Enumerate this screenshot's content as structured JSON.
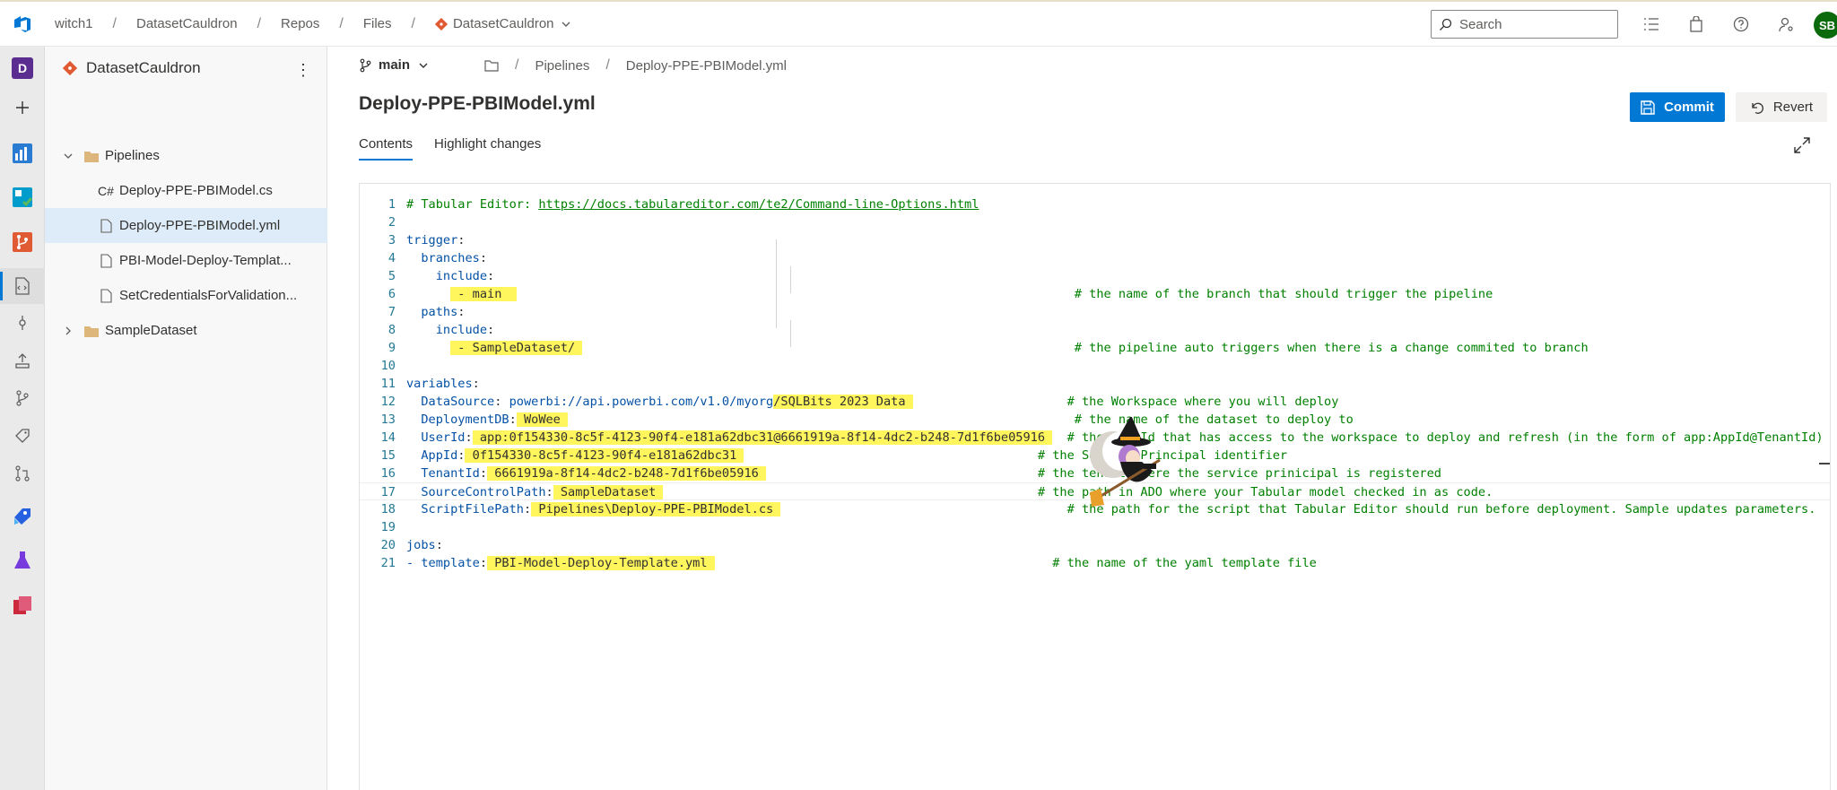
{
  "topbar": {
    "crumbs": [
      "witch1",
      "DatasetCauldron",
      "Repos",
      "Files"
    ],
    "repo_crumb": "DatasetCauldron",
    "search_placeholder": "Search",
    "avatar_initials": "SB"
  },
  "rail": {
    "project_badge": "D"
  },
  "tree": {
    "repo_name": "DatasetCauldron",
    "items": [
      {
        "label": "Pipelines",
        "type": "folder",
        "expanded": true
      },
      {
        "label": "Deploy-PPE-PBIModel.cs",
        "type": "cs-file",
        "prefix": "C#"
      },
      {
        "label": "Deploy-PPE-PBIModel.yml",
        "type": "file",
        "selected": true
      },
      {
        "label": "PBI-Model-Deploy-Templat...",
        "type": "file"
      },
      {
        "label": "SetCredentialsForValidation...",
        "type": "file"
      },
      {
        "label": "SampleDataset",
        "type": "folder",
        "expanded": false
      }
    ]
  },
  "main": {
    "branch": "main",
    "path": [
      "Pipelines",
      "Deploy-PPE-PBIModel.yml"
    ],
    "file_title": "Deploy-PPE-PBIModel.yml",
    "commit_label": "Commit",
    "revert_label": "Revert",
    "tabs": [
      "Contents",
      "Highlight changes"
    ],
    "active_tab": "Contents"
  },
  "code": {
    "lines": [
      [
        {
          "t": "# Tabular Editor: ",
          "c": "comment"
        },
        {
          "t": "https://docs.tabulareditor.com/te2/Command-line-Options.html",
          "c": "link"
        }
      ],
      [],
      [
        {
          "t": "trigger",
          "c": "key"
        },
        {
          "t": ":",
          "c": "plain"
        }
      ],
      [
        {
          "t": "  branches",
          "c": "key"
        },
        {
          "t": ":",
          "c": "plain"
        }
      ],
      [
        {
          "t": "    include",
          "c": "key"
        },
        {
          "t": ":",
          "c": "plain"
        }
      ],
      [
        {
          "t": "      ",
          "c": "plain"
        },
        {
          "t": " - main  ",
          "c": "plain",
          "hl": true
        },
        {
          "t": "                                                                            ",
          "c": "plain"
        },
        {
          "t": "# the name of the branch that should trigger the pipeline",
          "c": "comment"
        }
      ],
      [
        {
          "t": "  paths",
          "c": "key"
        },
        {
          "t": ":",
          "c": "plain"
        }
      ],
      [
        {
          "t": "    include",
          "c": "key"
        },
        {
          "t": ":",
          "c": "plain"
        }
      ],
      [
        {
          "t": "      ",
          "c": "plain"
        },
        {
          "t": " - SampleDataset/ ",
          "c": "plain",
          "hl": true
        },
        {
          "t": "                                                                   ",
          "c": "plain"
        },
        {
          "t": "# the pipeline auto triggers when there is a change commited to branch",
          "c": "comment"
        }
      ],
      [],
      [
        {
          "t": "variables",
          "c": "key"
        },
        {
          "t": ":",
          "c": "plain"
        }
      ],
      [
        {
          "t": "  DataSource",
          "c": "key"
        },
        {
          "t": ": ",
          "c": "plain"
        },
        {
          "t": "powerbi://api.powerbi.com/v1.0/myorg",
          "c": "key"
        },
        {
          "t": "/SQLBits 2023 Data ",
          "c": "plain",
          "hl": true
        },
        {
          "t": "                     ",
          "c": "plain"
        },
        {
          "t": "# the Workspace where you will deploy",
          "c": "comment"
        }
      ],
      [
        {
          "t": "  DeploymentDB",
          "c": "key"
        },
        {
          "t": ":",
          "c": "plain"
        },
        {
          "t": " WoWee ",
          "c": "plain",
          "hl": true
        },
        {
          "t": "                                                                     ",
          "c": "plain"
        },
        {
          "t": "# the name of the dataset to deploy to",
          "c": "comment"
        }
      ],
      [
        {
          "t": "  UserId",
          "c": "key"
        },
        {
          "t": ":",
          "c": "plain"
        },
        {
          "t": " app:0f154330-8c5f-4123-90f4-e181a62dbc31@6661919a-8f14-4dc2-b248-7d1f6be05916 ",
          "c": "plain",
          "hl": true
        },
        {
          "t": "  ",
          "c": "plain"
        },
        {
          "t": "# the UserId that has access to the workspace to deploy and refresh (in the form of app:AppId@TenantId)",
          "c": "comment"
        }
      ],
      [
        {
          "t": "  AppId",
          "c": "key"
        },
        {
          "t": ":",
          "c": "plain"
        },
        {
          "t": " 0f154330-8c5f-4123-90f4-e181a62dbc31 ",
          "c": "plain",
          "hl": true
        },
        {
          "t": "                                        ",
          "c": "plain"
        },
        {
          "t": "# the Service Principal identifier",
          "c": "comment"
        }
      ],
      [
        {
          "t": "  TenantId",
          "c": "key"
        },
        {
          "t": ":",
          "c": "plain"
        },
        {
          "t": " 6661919a-8f14-4dc2-b248-7d1f6be05916 ",
          "c": "plain",
          "hl": true
        },
        {
          "t": "                                     ",
          "c": "plain"
        },
        {
          "t": "# the tenant where the service prinicipal is registered",
          "c": "comment"
        }
      ],
      [
        {
          "t": "  SourceControlPath",
          "c": "key"
        },
        {
          "t": ":",
          "c": "plain"
        },
        {
          "t": " SampleDataset ",
          "c": "plain",
          "hl": true
        },
        {
          "t": "                                                   ",
          "c": "plain"
        },
        {
          "t": "# the path in ADO where your Tabular model checked in as code.",
          "c": "comment"
        }
      ],
      [
        {
          "t": "  ScriptFilePath",
          "c": "key"
        },
        {
          "t": ":",
          "c": "plain"
        },
        {
          "t": " Pipelines\\Deploy-PPE-PBIModel.cs ",
          "c": "plain",
          "hl": true
        },
        {
          "t": "                                       ",
          "c": "plain"
        },
        {
          "t": "# the path for the script that Tabular Editor should run before deployment. Sample updates parameters.",
          "c": "comment"
        }
      ],
      [],
      [
        {
          "t": "jobs",
          "c": "key"
        },
        {
          "t": ":",
          "c": "plain"
        }
      ],
      [
        {
          "t": "- template",
          "c": "key"
        },
        {
          "t": ":",
          "c": "plain"
        },
        {
          "t": " PBI-Model-Deploy-Template.yml ",
          "c": "plain",
          "hl": true
        },
        {
          "t": "                                              ",
          "c": "plain"
        },
        {
          "t": "# the name of the yaml template file",
          "c": "comment"
        }
      ]
    ],
    "current_line": 17
  }
}
